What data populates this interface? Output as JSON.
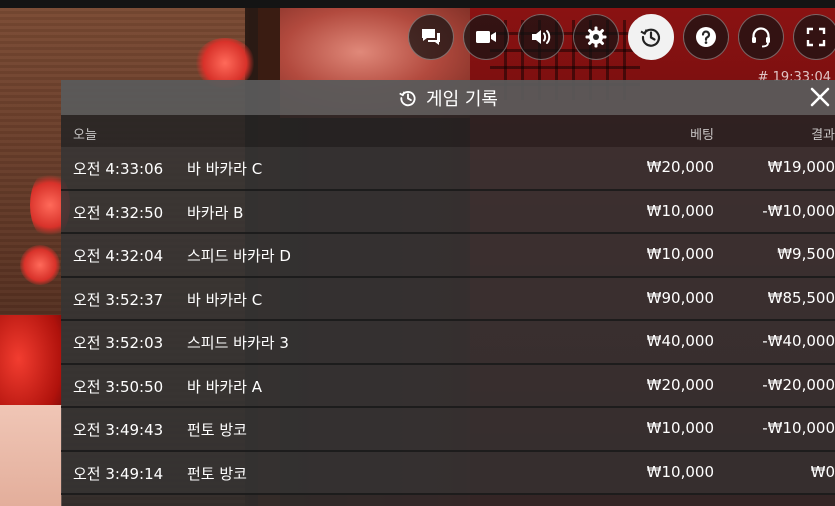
{
  "toolbar": {
    "buttons": [
      {
        "icon": "chat-icon",
        "active": false
      },
      {
        "icon": "video-camera-icon",
        "active": false
      },
      {
        "icon": "speaker-icon",
        "active": false
      },
      {
        "icon": "gear-icon",
        "active": false
      },
      {
        "icon": "history-icon",
        "active": true
      },
      {
        "icon": "help-icon",
        "active": false
      },
      {
        "icon": "headset-icon",
        "active": false
      },
      {
        "icon": "fullscreen-icon",
        "active": false
      }
    ]
  },
  "timestamp": "# 19:33:04",
  "history": {
    "title": "게임 기록",
    "columns": {
      "date": "오늘",
      "bet": "베팅",
      "result": "결과"
    },
    "rows": [
      {
        "time": "오전 4:33:06",
        "game": "바 바카라 C",
        "bet": "₩20,000",
        "result": "₩19,000"
      },
      {
        "time": "오전 4:32:50",
        "game": "바카라 B",
        "bet": "₩10,000",
        "result": "-₩10,000"
      },
      {
        "time": "오전 4:32:04",
        "game": "스피드 바카라 D",
        "bet": "₩10,000",
        "result": "₩9,500"
      },
      {
        "time": "오전 3:52:37",
        "game": "바 바카라 C",
        "bet": "₩90,000",
        "result": "₩85,500"
      },
      {
        "time": "오전 3:52:03",
        "game": "스피드 바카라 3",
        "bet": "₩40,000",
        "result": "-₩40,000"
      },
      {
        "time": "오전 3:50:50",
        "game": "바 바카라 A",
        "bet": "₩20,000",
        "result": "-₩20,000"
      },
      {
        "time": "오전 3:49:43",
        "game": "펀토 방코",
        "bet": "₩10,000",
        "result": "-₩10,000"
      },
      {
        "time": "오전 3:49:14",
        "game": "펀토 방코",
        "bet": "₩10,000",
        "result": "₩0"
      }
    ]
  }
}
